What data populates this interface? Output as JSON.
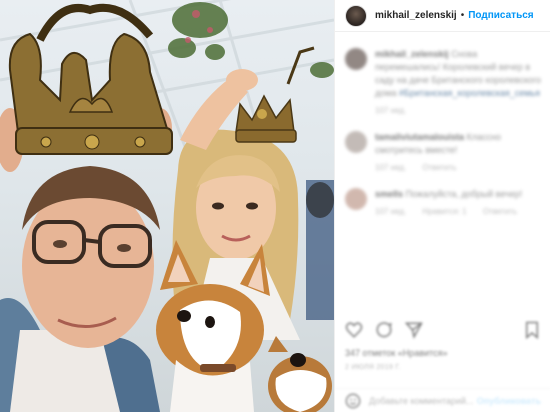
{
  "header": {
    "username": "mikhail_zelenskij",
    "separator": "•",
    "follow_label": "Подписаться"
  },
  "comments": [
    {
      "username": "mikhail_zelenskij",
      "text": "Снова перемешались! Королевский вечер в саду на даче Британского королевского дома",
      "hashtag": "#Британская_королевская_семья",
      "meta": [
        "107 нед."
      ]
    },
    {
      "username": "tamaliviutamalouista",
      "text": "Классно смотритесь вместе!",
      "meta": [
        "107 нед.",
        "Ответить"
      ]
    },
    {
      "username": "smells",
      "text": "Пожалуйста, добрый вечер!",
      "meta": [
        "107 нед.",
        "Нравится: 1",
        "Ответить"
      ]
    }
  ],
  "likes_text": "347 отметок «Нравится»",
  "date_text": "2 ИЮЛЯ 2019 Г.",
  "add_comment": {
    "placeholder": "Добавьте комментарий...",
    "publish_label": "Опубликовать"
  },
  "colors": {
    "accent": "#0095f6",
    "text": "#262626",
    "muted": "#8e8e8e"
  },
  "icons": [
    "heart-icon",
    "comment-icon",
    "share-icon",
    "bookmark-icon",
    "emoji-icon"
  ]
}
